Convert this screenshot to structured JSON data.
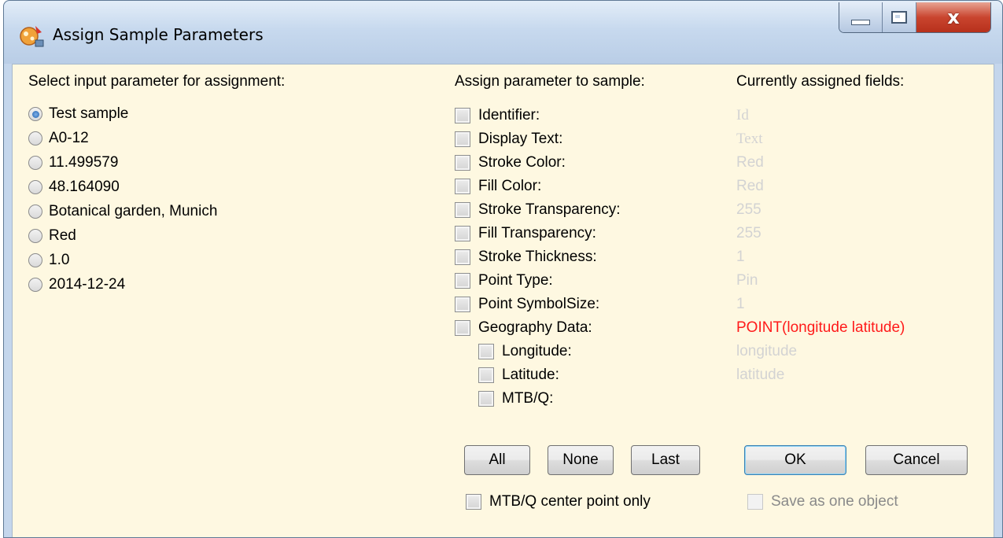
{
  "window": {
    "title": "Assign Sample Parameters",
    "controls": {
      "minimize": "minimize",
      "maximize": "maximize",
      "close": "x"
    }
  },
  "left": {
    "header": "Select input parameter for assignment:",
    "options": [
      {
        "label": "Test sample",
        "selected": true
      },
      {
        "label": "A0-12",
        "selected": false
      },
      {
        "label": "11.499579",
        "selected": false
      },
      {
        "label": "48.164090",
        "selected": false
      },
      {
        "label": "Botanical garden, Munich",
        "selected": false
      },
      {
        "label": "Red",
        "selected": false
      },
      {
        "label": "1.0",
        "selected": false
      },
      {
        "label": "2014-12-24",
        "selected": false
      }
    ]
  },
  "middle": {
    "header": "Assign parameter to sample:",
    "fields": [
      {
        "label": "Identifier:",
        "checked": false
      },
      {
        "label": "Display Text:",
        "checked": false
      },
      {
        "label": "Stroke Color:",
        "checked": false
      },
      {
        "label": "Fill Color:",
        "checked": false
      },
      {
        "label": "Stroke Transparency:",
        "checked": false
      },
      {
        "label": "Fill Transparency:",
        "checked": false
      },
      {
        "label": "Stroke Thickness:",
        "checked": false
      },
      {
        "label": "Point Type:",
        "checked": false
      },
      {
        "label": "Point SymbolSize:",
        "checked": false
      },
      {
        "label": "Geography Data:",
        "checked": false
      }
    ],
    "subfields": [
      {
        "label": "Longitude:",
        "checked": false
      },
      {
        "label": "Latitude:",
        "checked": false
      },
      {
        "label": "MTB/Q:",
        "checked": false
      }
    ],
    "buttons": {
      "all": "All",
      "none": "None",
      "last": "Last"
    },
    "mtb_center": "MTB/Q center point only"
  },
  "right": {
    "header": "Currently assigned fields:",
    "values": [
      "Id",
      "Text",
      "Red",
      "Red",
      "255",
      "255",
      "1",
      "Pin",
      "1",
      "POINT(longitude latitude)",
      "longitude",
      "latitude"
    ],
    "ok": "OK",
    "cancel": "Cancel",
    "save_one": "Save as one object"
  },
  "colors": {
    "background": "#fef8e1",
    "highlight": "#ff1a1a",
    "frame": "#c4d6ec"
  }
}
